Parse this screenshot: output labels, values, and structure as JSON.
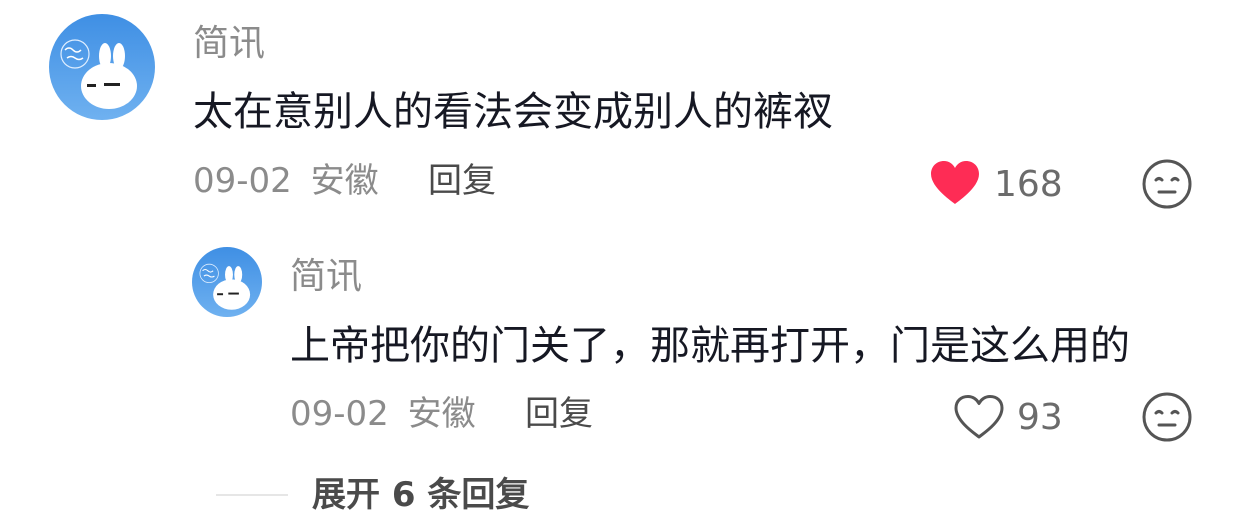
{
  "comment": {
    "username": "简讯",
    "text": "太在意别人的看法会变成别人的裤衩",
    "date": "09-02",
    "location": "安徽",
    "reply_label": "回复",
    "like_count": "168",
    "liked": true,
    "like_icon": "heart-filled-icon",
    "dislike_icon": "neutral-face-icon"
  },
  "reply": {
    "username": "简讯",
    "text": "上帝把你的门关了，那就再打开，门是这么用的",
    "date": "09-02",
    "location": "安徽",
    "reply_label": "回复",
    "like_count": "93",
    "liked": false,
    "like_icon": "heart-outline-icon",
    "dislike_icon": "neutral-face-icon"
  },
  "expand": {
    "label": "展开 6 条回复"
  },
  "colors": {
    "like_active": "#fe2c55",
    "avatar_bg": "#3d8fe0",
    "text_primary": "#161823",
    "text_secondary": "#8b8b8b"
  }
}
